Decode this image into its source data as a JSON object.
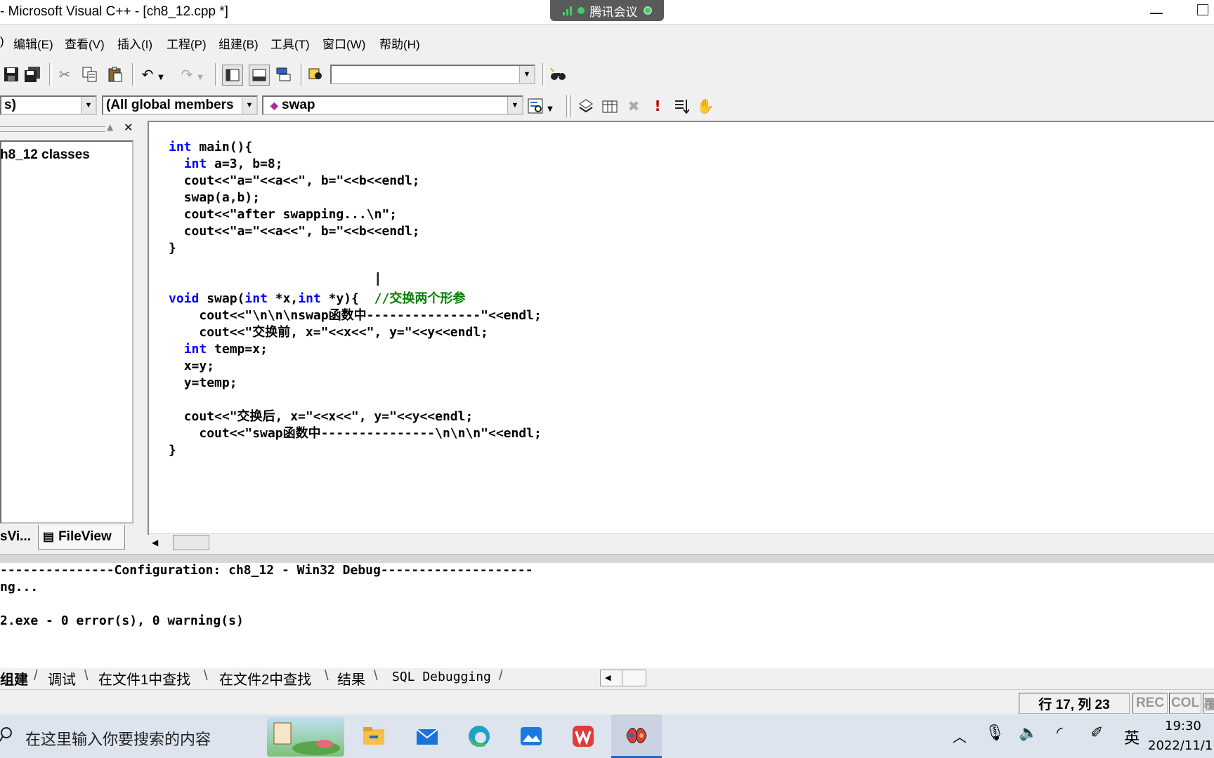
{
  "window": {
    "title": "- Microsoft Visual C++ - [ch8_12.cpp *]",
    "meeting_label": "腾讯会议",
    "minimize": "—"
  },
  "menu": [
    ")",
    "编辑(E)",
    "查看(V)",
    "插入(I)",
    "工程(P)",
    "组建(B)",
    "工具(T)",
    "窗口(W)",
    "帮助(H)"
  ],
  "toolbar2": {
    "class_combo": "s)",
    "filter_combo": "(All global members",
    "member_combo": "swap"
  },
  "left_pane": {
    "tree_item": "h8_12 classes",
    "tab_classview": "sVi...",
    "tab_fileview": "FileView"
  },
  "code_lines": [
    {
      "indent": "",
      "parts": [
        {
          "t": "int",
          "k": "kw"
        },
        {
          "t": " main(){",
          "k": ""
        }
      ]
    },
    {
      "indent": "  ",
      "parts": [
        {
          "t": "int",
          "k": "kw"
        },
        {
          "t": " a=3, b=8;",
          "k": ""
        }
      ]
    },
    {
      "indent": "  ",
      "parts": [
        {
          "t": "cout<<\"a=\"<<a<<\", b=\"<<b<<endl;",
          "k": ""
        }
      ]
    },
    {
      "indent": "  ",
      "parts": [
        {
          "t": "swap(a,b);",
          "k": ""
        }
      ]
    },
    {
      "indent": "  ",
      "parts": [
        {
          "t": "cout<<\"after swapping...\\n\";",
          "k": ""
        }
      ]
    },
    {
      "indent": "  ",
      "parts": [
        {
          "t": "cout<<\"a=\"<<a<<\", b=\"<<b<<endl;",
          "k": ""
        }
      ]
    },
    {
      "indent": "",
      "parts": [
        {
          "t": "}",
          "k": ""
        }
      ]
    },
    {
      "indent": "",
      "parts": []
    },
    {
      "indent": "",
      "parts": []
    },
    {
      "indent": "",
      "parts": [
        {
          "t": "void",
          "k": "kw"
        },
        {
          "t": " swap(",
          "k": ""
        },
        {
          "t": "int",
          "k": "kw"
        },
        {
          "t": " *x,",
          "k": ""
        },
        {
          "t": "int",
          "k": "kw"
        },
        {
          "t": " *y){  ",
          "k": ""
        },
        {
          "t": "//交换两个形参",
          "k": "cm"
        }
      ]
    },
    {
      "indent": "    ",
      "parts": [
        {
          "t": "cout<<\"\\n\\n\\nswap函数中---------------\"<<endl;",
          "k": ""
        }
      ]
    },
    {
      "indent": "    ",
      "parts": [
        {
          "t": "cout<<\"交换前, x=\"<<x<<\", y=\"<<y<<endl;",
          "k": ""
        }
      ]
    },
    {
      "indent": "  ",
      "parts": [
        {
          "t": "int",
          "k": "kw"
        },
        {
          "t": " temp=x;",
          "k": ""
        }
      ]
    },
    {
      "indent": "  ",
      "parts": [
        {
          "t": "x=y;",
          "k": ""
        }
      ]
    },
    {
      "indent": "  ",
      "parts": [
        {
          "t": "y=temp;",
          "k": ""
        }
      ]
    },
    {
      "indent": "",
      "parts": []
    },
    {
      "indent": "  ",
      "parts": [
        {
          "t": "cout<<\"交换后, x=\"<<x<<\", y=\"<<y<<endl;",
          "k": ""
        }
      ]
    },
    {
      "indent": "    ",
      "parts": [
        {
          "t": "cout<<\"swap函数中---------------\\n\\n\\n\"<<endl;",
          "k": ""
        }
      ]
    },
    {
      "indent": "",
      "parts": [
        {
          "t": "}",
          "k": ""
        }
      ]
    }
  ],
  "output": {
    "line1": "---------------Configuration: ch8_12 - Win32 Debug--------------------",
    "line2": "ng...",
    "line3": "2.exe - 0 error(s), 0 warning(s)"
  },
  "output_tabs": [
    "组建",
    "调试",
    "在文件1中查找",
    "在文件2中查找",
    "结果",
    "SQL Debugging"
  ],
  "status": {
    "position": "行 17, 列 23",
    "rec": "REC",
    "col": "COL",
    "ovr": "覆"
  },
  "taskbar": {
    "search_placeholder": "在这里输入你要搜索的内容",
    "ime": "英",
    "time": "19:30",
    "date": "2022/11/1"
  },
  "colors": {
    "keyword": "#0000ff",
    "comment": "#008000",
    "accent": "#2a66c8"
  }
}
